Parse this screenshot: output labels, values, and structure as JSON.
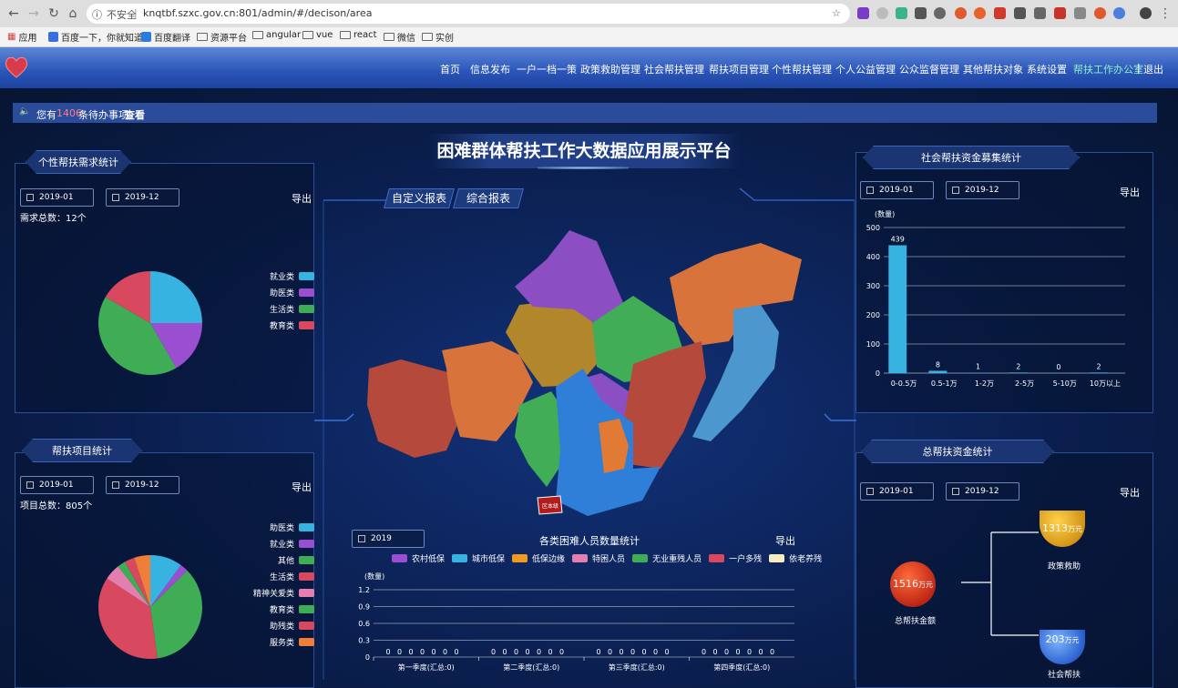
{
  "browser": {
    "security": "不安全",
    "url": "knqtbf.szxc.gov.cn:801/admin/#/decison/area",
    "bookmarks": [
      "应用",
      "百度一下，你就知道",
      "百度翻译",
      "资源平台",
      "angular",
      "vue",
      "react",
      "微信",
      "实创"
    ]
  },
  "nav": {
    "items": [
      "首页",
      "信息发布",
      "一户一档一策",
      "政策救助管理",
      "社会帮扶管理",
      "帮扶项目管理",
      "个性帮扶管理",
      "个人公益管理",
      "公众监督管理",
      "其他帮扶对象",
      "系统设置"
    ],
    "active": "帮扶工作办公室",
    "logout": "退出"
  },
  "notice": {
    "pre": "您有",
    "count": "1406",
    "post": "条待办事项",
    "link": "查看"
  },
  "title": "困难群体帮扶工作大数据应用展示平台",
  "report_buttons": [
    "自定义报表",
    "综合报表"
  ],
  "map": {
    "label": "区本级"
  },
  "colors": {
    "cyan": "#36b3e0",
    "purple": "#9a4fd0",
    "green": "#3fad56",
    "red": "#d8485e",
    "pink": "#e27fae",
    "orange": "#ef7e3a",
    "amber": "#e09a20"
  },
  "panel_demand": {
    "title": "个性帮扶需求统计",
    "start": "2019-01",
    "end": "2019-12",
    "export": "导出",
    "total_label": "需求总数：12个"
  },
  "panel_project": {
    "title": "帮扶项目统计",
    "start": "2019-01",
    "end": "2019-12",
    "export": "导出",
    "total_label": "项目总数：805个"
  },
  "panel_fund_raise": {
    "title": "社会帮扶资金募集统计",
    "start": "2019-01",
    "end": "2019-12",
    "export": "导出"
  },
  "panel_total_fund": {
    "title": "总帮扶资金统计",
    "start": "2019-01",
    "end": "2019-12",
    "export": "导出",
    "total": {
      "value": "1516",
      "unit": "万元",
      "label": "总帮扶金额"
    },
    "policy": {
      "value": "1313",
      "unit": "万元",
      "label": "政策救助"
    },
    "social": {
      "value": "203",
      "unit": "万元",
      "label": "社会帮扶"
    }
  },
  "panel_people": {
    "year": "2019",
    "title": "各类困难人员数量统计",
    "export": "导出"
  },
  "chart_data": [
    {
      "type": "pie",
      "legend": [
        "就业类",
        "助医类",
        "生活类",
        "教育类"
      ],
      "values": [
        3,
        2,
        5,
        2
      ],
      "colors": [
        "#36b3e0",
        "#9a4fd0",
        "#3fad56",
        "#d8485e"
      ],
      "legend_position": "right"
    },
    {
      "type": "pie",
      "legend": [
        "助医类",
        "就业类",
        "其他",
        "生活类",
        "精神关爱类",
        "教育类",
        "助残类",
        "服务类"
      ],
      "values": [
        80,
        20,
        280,
        290,
        40,
        20,
        25,
        40
      ],
      "colors": [
        "#36b3e0",
        "#9a4fd0",
        "#3fad56",
        "#d8485e",
        "#e27fae",
        "#3fad56",
        "#d8485e",
        "#ef7e3a"
      ],
      "legend_position": "right"
    },
    {
      "type": "bar",
      "categories": [
        "0-0.5万",
        "0.5-1万",
        "1-2万",
        "2-5万",
        "5-10万",
        "10万以上"
      ],
      "values": [
        439,
        8,
        1,
        2,
        0,
        2
      ],
      "ylabel": "(数量)",
      "ylim": [
        0,
        500
      ],
      "yticks": [
        0,
        100,
        200,
        300,
        400,
        500
      ],
      "color": "#36b3e0"
    },
    {
      "type": "bar",
      "categories": [
        "第一季度(汇总:0)",
        "第二季度(汇总:0)",
        "第三季度(汇总:0)",
        "第四季度(汇总:0)"
      ],
      "series": [
        {
          "name": "农村低保",
          "color": "#9a4fd0",
          "values": [
            0,
            0,
            0,
            0
          ]
        },
        {
          "name": "城市低保",
          "color": "#36b3e0",
          "values": [
            0,
            0,
            0,
            0
          ]
        },
        {
          "name": "低保边缘",
          "color": "#ef9a20",
          "values": [
            0,
            0,
            0,
            0
          ]
        },
        {
          "name": "特困人员",
          "color": "#e27fae",
          "values": [
            0,
            0,
            0,
            0
          ]
        },
        {
          "name": "无业重残人员",
          "color": "#3fad56",
          "values": [
            0,
            0,
            0,
            0
          ]
        },
        {
          "name": "一户多残",
          "color": "#d8485e",
          "values": [
            0,
            0,
            0,
            0
          ]
        },
        {
          "name": "依老养残",
          "color": "#f6edc0",
          "values": [
            0,
            0,
            0,
            0
          ]
        }
      ],
      "ylabel": "(数量)",
      "ylim": [
        0,
        1.2
      ],
      "yticks": [
        "0",
        "0.3",
        "0.6",
        "0.9",
        "1.2"
      ],
      "legend_position": "top"
    }
  ]
}
